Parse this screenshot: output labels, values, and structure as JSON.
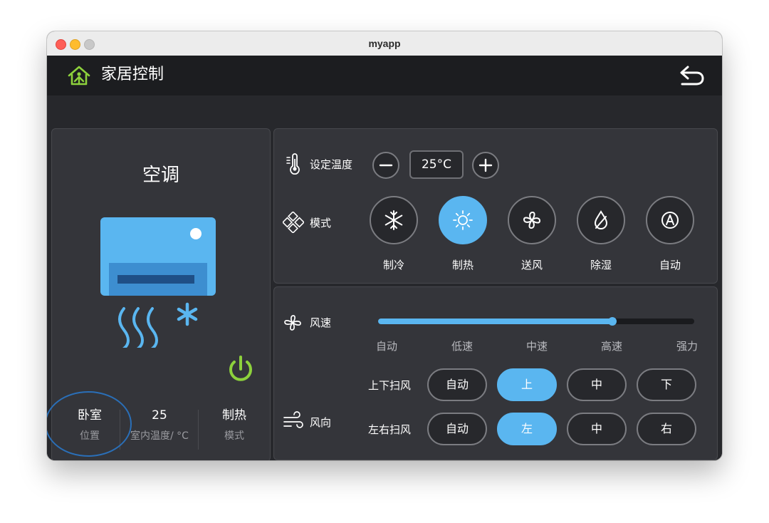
{
  "window": {
    "title": "myapp"
  },
  "header": {
    "title": "家居控制"
  },
  "device": {
    "name": "空调",
    "info": [
      {
        "value": "卧室",
        "label": "位置"
      },
      {
        "value": "25",
        "label": "室内温度/ °C"
      },
      {
        "value": "制热",
        "label": "模式"
      }
    ]
  },
  "temperature": {
    "label": "设定温度",
    "value": "25°C"
  },
  "mode": {
    "label": "模式",
    "options": [
      {
        "label": "制冷",
        "icon": "snowflake-icon",
        "active": false
      },
      {
        "label": "制热",
        "icon": "sun-icon",
        "active": true
      },
      {
        "label": "送风",
        "icon": "fan-icon",
        "active": false
      },
      {
        "label": "除湿",
        "icon": "drop-icon",
        "active": false
      },
      {
        "label": "自动",
        "icon": "auto-icon",
        "active": false
      }
    ]
  },
  "fan_speed": {
    "label": "风速",
    "levels": [
      "自动",
      "低速",
      "中速",
      "高速",
      "强力"
    ],
    "value_fraction": 0.74
  },
  "wind_direction": {
    "label": "风向",
    "vertical": {
      "label": "上下扫风",
      "options": [
        "自动",
        "上",
        "中",
        "下"
      ],
      "selected": "上"
    },
    "horizontal": {
      "label": "左右扫风",
      "options": [
        "自动",
        "左",
        "中",
        "右"
      ],
      "selected": "左"
    }
  },
  "colors": {
    "accent": "#5ab6f0",
    "power": "#8dd13c",
    "home_icon": "#8dd13c",
    "panel": "#34353a",
    "background": "#27282c"
  }
}
